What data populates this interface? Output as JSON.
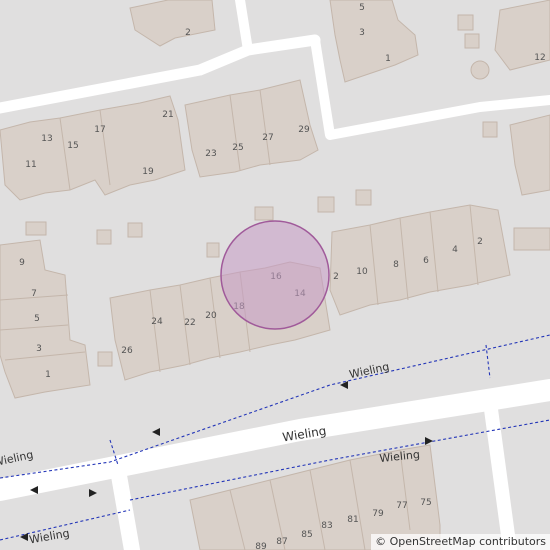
{
  "map": {
    "streets": [
      {
        "name": "Wieling"
      },
      {
        "name": "Wieling"
      },
      {
        "name": "Wieling"
      },
      {
        "name": "Wieling"
      },
      {
        "name": "Wieling"
      }
    ],
    "house_numbers": [
      "2",
      "5",
      "3",
      "1",
      "12",
      "21",
      "13",
      "17",
      "15",
      "11",
      "19",
      "23",
      "25",
      "27",
      "29",
      "9",
      "7",
      "5",
      "3",
      "1",
      "24",
      "22",
      "20",
      "18",
      "26",
      "16",
      "14",
      "2",
      "10",
      "8",
      "6",
      "4",
      "2",
      "89",
      "87",
      "85",
      "83",
      "81",
      "79",
      "77",
      "75"
    ],
    "marker": {
      "label": "selected location",
      "fill": "#d4b6d0",
      "stroke": "#a05a9a"
    },
    "colors": {
      "background": "#e0dfdf",
      "building": "#d9d0c9",
      "building_outline": "#c4b6ab",
      "road": "#ffffff",
      "path": "#2436b8"
    }
  },
  "attribution": {
    "prefix": "©",
    "text": "OpenStreetMap contributors"
  }
}
